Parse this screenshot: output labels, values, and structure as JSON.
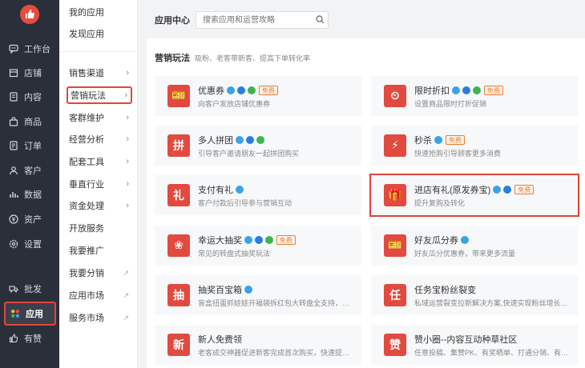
{
  "nav": {
    "items": [
      {
        "label": "工作台",
        "icon": "chat-icon"
      },
      {
        "label": "店铺",
        "icon": "store-icon"
      },
      {
        "label": "内容",
        "icon": "document-icon"
      },
      {
        "label": "商品",
        "icon": "bag-icon"
      },
      {
        "label": "订单",
        "icon": "order-icon"
      },
      {
        "label": "客户",
        "icon": "user-icon"
      },
      {
        "label": "数据",
        "icon": "bar-chart-icon"
      },
      {
        "label": "资产",
        "icon": "yen-icon"
      },
      {
        "label": "设置",
        "icon": "gear-icon"
      }
    ],
    "bottom": [
      {
        "label": "批发",
        "icon": "truck-icon"
      },
      {
        "label": "应用",
        "icon": "apps-icon"
      },
      {
        "label": "有赞",
        "icon": "thumb-up-icon"
      }
    ]
  },
  "sub": {
    "items": [
      {
        "label": "我的应用"
      },
      {
        "label": "发现应用"
      },
      {
        "label": "销售渠道"
      },
      {
        "label": "营销玩法"
      },
      {
        "label": "客群维护"
      },
      {
        "label": "经营分析"
      },
      {
        "label": "配套工具"
      },
      {
        "label": "垂直行业"
      },
      {
        "label": "资金处理"
      },
      {
        "label": "开放服务"
      },
      {
        "label": "我要推广"
      },
      {
        "label": "我要分销"
      },
      {
        "label": "应用市场"
      },
      {
        "label": "服务市场"
      }
    ]
  },
  "main": {
    "title": "应用中心",
    "search_placeholder": "搜索应用和运营攻略",
    "section_title": "营销玩法",
    "section_desc": "吸粉、老客带新客、提高下单转化率",
    "free_label": "免费",
    "cards": [
      {
        "title": "优惠券",
        "desc": "向客户发放店铺优惠券",
        "glyph": "🎫",
        "badges": 3,
        "free": true
      },
      {
        "title": "限时折扣",
        "desc": "设置商品限时打折促销",
        "glyph": "⏲",
        "badges": 3,
        "free": true
      },
      {
        "title": "多人拼团",
        "desc": "引导客户邀请朋友一起拼团购买",
        "glyph": "拼",
        "badges": 3,
        "free": false
      },
      {
        "title": "秒杀",
        "desc": "快速抢购引导顾客更多消费",
        "glyph": "⚡",
        "badges": 1,
        "free": true
      },
      {
        "title": "支付有礼",
        "desc": "客户付款后引导参与营销互动",
        "glyph": "礼",
        "badges": 1,
        "free": false
      },
      {
        "title": "进店有礼(原发券宝)",
        "desc": "提升复购及转化",
        "glyph": "🎁",
        "badges": 2,
        "free": true
      },
      {
        "title": "幸运大抽奖",
        "desc": "常见的转盘式抽奖玩法",
        "glyph": "❀",
        "badges": 3,
        "free": true
      },
      {
        "title": "好友瓜分券",
        "desc": "好友瓜分优惠券，带来更多流量",
        "glyph": "🎫",
        "badges": 1,
        "free": false
      },
      {
        "title": "抽奖百宝箱",
        "desc": "盲盒扭蛋抓娃娃开福袋拆红包大转盘全支持，付费抽...",
        "glyph": "抽",
        "badges": 1,
        "free": false
      },
      {
        "title": "任务宝粉丝裂变",
        "desc": "私域运营裂变拉新解决方案,快速实现粉丝增长，公...",
        "glyph": "任",
        "badges": 0,
        "free": false
      },
      {
        "title": "新人免费领",
        "desc": "老客成交神器促进新客完成首次购买，快速提升新客...",
        "glyph": "新",
        "badges": 0,
        "free": false
      },
      {
        "title": "赞小圈--内容互动种草社区",
        "desc": "任意投稿、集赞PK、有奖晒单、打通分销、有奖晒...",
        "glyph": "赞",
        "badges": 0,
        "free": false
      }
    ]
  }
}
